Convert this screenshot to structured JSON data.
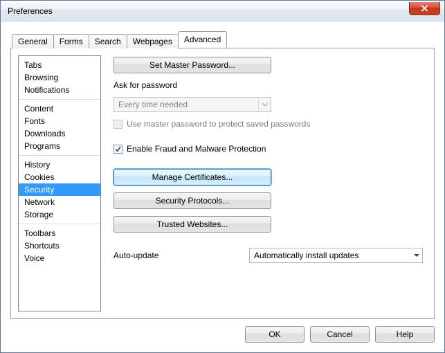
{
  "titlebar": {
    "title": "Preferences"
  },
  "tabs": [
    {
      "label": "General"
    },
    {
      "label": "Forms"
    },
    {
      "label": "Search"
    },
    {
      "label": "Webpages"
    },
    {
      "label": "Advanced"
    }
  ],
  "sidebar": {
    "groups": [
      [
        "Tabs",
        "Browsing",
        "Notifications"
      ],
      [
        "Content",
        "Fonts",
        "Downloads",
        "Programs"
      ],
      [
        "History",
        "Cookies",
        "Security",
        "Network",
        "Storage"
      ],
      [
        "Toolbars",
        "Shortcuts",
        "Voice"
      ]
    ],
    "selected": "Security"
  },
  "main": {
    "set_master_password": "Set Master Password...",
    "ask_for_password": "Ask for password",
    "password_mode": "Every time needed",
    "use_master_password_protect": "Use master password to protect saved passwords",
    "enable_fraud_protection": "Enable Fraud and Malware Protection",
    "manage_certificates": "Manage Certificates...",
    "security_protocols": "Security Protocols...",
    "trusted_websites": "Trusted Websites...",
    "auto_update_label": "Auto-update",
    "auto_update_value": "Automatically install updates"
  },
  "footer": {
    "ok": "OK",
    "cancel": "Cancel",
    "help": "Help"
  }
}
